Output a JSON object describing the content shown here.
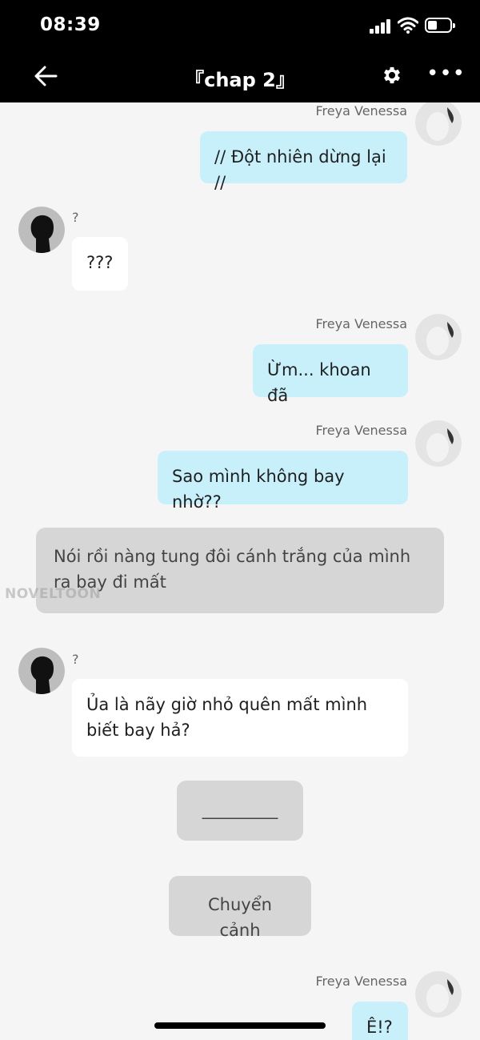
{
  "status_bar": {
    "time": "08:39"
  },
  "nav": {
    "title": "『chap 2』",
    "back_icon": "arrow-left-icon",
    "settings_icon": "gear-icon",
    "more_icon": "more-dots-icon"
  },
  "messages": [
    {
      "sender": "Freya Venessa",
      "text": "// Đột nhiên dừng lại //"
    },
    {
      "sender": "?",
      "text": "???"
    },
    {
      "sender": "Freya Venessa",
      "text": "Ừm...  khoan đã"
    },
    {
      "sender": "Freya Venessa",
      "text": "Sao mình không bay nhờ??"
    },
    {
      "narration": "Nói rồi nàng tung đôi cánh trắng của mình ra bay đi mất"
    },
    {
      "sender": "?",
      "text": "Ủa là nãy giờ nhỏ quên mất mình biết bay hả?"
    },
    {
      "narration": "_________"
    },
    {
      "narration": "Chuyển cảnh"
    },
    {
      "sender": "Freya Venessa",
      "text": "Ê!?"
    }
  ],
  "watermark": "NOVELTOON",
  "colors": {
    "my_bubble": "#c8f0fb",
    "other_bubble": "#ffffff",
    "narration_bubble": "#d6d6d6",
    "background": "#f5f5f5"
  }
}
